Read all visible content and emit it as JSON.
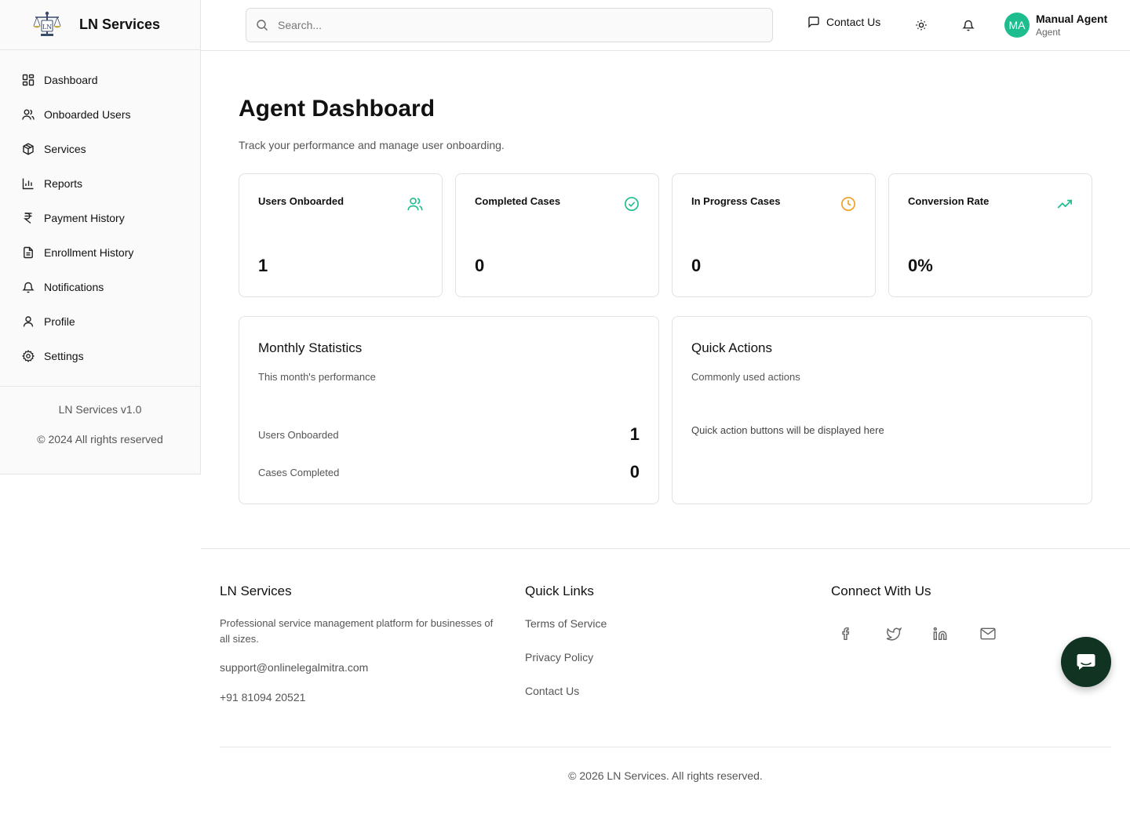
{
  "brand": {
    "name": "LN Services",
    "logo_icon": "scales-of-justice-logo"
  },
  "sidebar": {
    "items": [
      {
        "label": "Dashboard",
        "icon": "grid-icon"
      },
      {
        "label": "Onboarded Users",
        "icon": "users-icon"
      },
      {
        "label": "Services",
        "icon": "package-icon"
      },
      {
        "label": "Reports",
        "icon": "bar-chart-icon"
      },
      {
        "label": "Payment History",
        "icon": "rupee-icon"
      },
      {
        "label": "Enrollment History",
        "icon": "file-text-icon"
      },
      {
        "label": "Notifications",
        "icon": "bell-icon"
      },
      {
        "label": "Profile",
        "icon": "user-icon"
      },
      {
        "label": "Settings",
        "icon": "gear-icon"
      }
    ],
    "version": "LN Services v1.0",
    "copyright": "© 2024 All rights reserved"
  },
  "header": {
    "search_placeholder": "Search...",
    "contact_label": "Contact Us",
    "user": {
      "initials": "MA",
      "name": "Manual Agent",
      "role": "Agent"
    }
  },
  "main": {
    "title": "Agent Dashboard",
    "subtitle": "Track your performance and manage user onboarding.",
    "stats": [
      {
        "title": "Users Onboarded",
        "value": "1",
        "icon": "users-icon",
        "color": "#1dbd8f"
      },
      {
        "title": "Completed Cases",
        "value": "0",
        "icon": "check-circle-icon",
        "color": "#1dbd8f"
      },
      {
        "title": "In Progress Cases",
        "value": "0",
        "icon": "clock-icon",
        "color": "#f0a020"
      },
      {
        "title": "Conversion Rate",
        "value": "0%",
        "icon": "trending-up-icon",
        "color": "#1dbd8f"
      }
    ],
    "monthly": {
      "title": "Monthly Statistics",
      "subtitle": "This month's performance",
      "rows": [
        {
          "label": "Users Onboarded",
          "value": "1"
        },
        {
          "label": "Cases Completed",
          "value": "0"
        }
      ]
    },
    "quick_actions": {
      "title": "Quick Actions",
      "subtitle": "Commonly used actions",
      "placeholder": "Quick action buttons will be displayed here"
    }
  },
  "footer": {
    "about": {
      "title": "LN Services",
      "description": "Professional service management platform for businesses of all sizes.",
      "email": "support@onlinelegalmitra.com",
      "phone": "+91 81094 20521"
    },
    "links": {
      "title": "Quick Links",
      "items": [
        "Terms of Service",
        "Privacy Policy",
        "Contact Us"
      ]
    },
    "connect": {
      "title": "Connect With Us",
      "icons": [
        "facebook-icon",
        "twitter-icon",
        "linkedin-icon",
        "mail-icon"
      ]
    },
    "copyright": "© 2026 LN Services. All rights reserved."
  },
  "colors": {
    "accent": "#1dbd8f",
    "warning": "#f0a020",
    "chat_button": "#113322"
  }
}
